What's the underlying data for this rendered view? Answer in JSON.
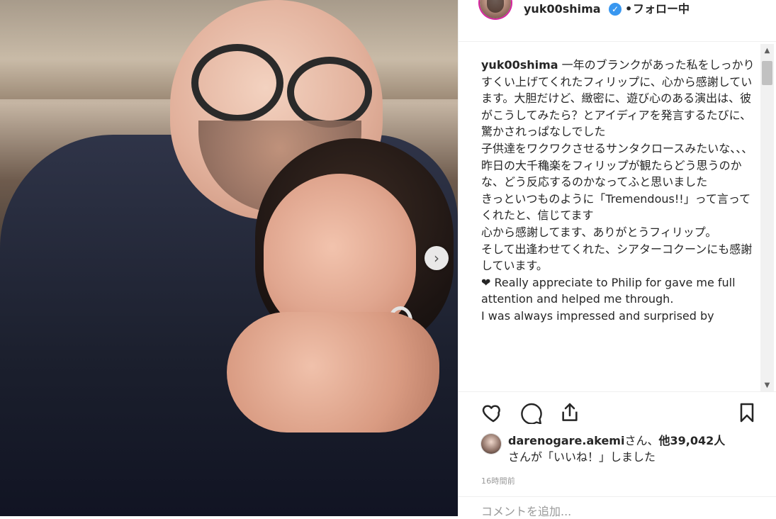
{
  "post": {
    "username": "yuk00shima",
    "dot": "•",
    "follow_status": "フォロー中",
    "caption_author": "yuk00shima",
    "caption_text": " 一年のブランクがあった私をしっかりすくい上げてくれたフィリップに、心から感謝しています。大胆だけど、緻密に、遊び心のある演出は、彼がこうしてみたら？とアイディアを発言するたびに、驚かされっぱなしでした\n子供達をワクワクさせるサンタクロースみたいな、、、\n昨日の大千穐楽をフィリップが観たらどう思うのかな、どう反応するのかなってふと思いました\nきっといつものように「Tremendous!!」って言ってくれたと、信じてます\n心から感謝してます、ありがとうフィリップ。\nそして出逢わせてくれた、シアターコクーンにも感謝しています。\n❤ Really appreciate to Philip for gave me full attention and helped me through.\nI was always impressed and surprised by",
    "likes": {
      "user": "darenogare.akemi",
      "middle": "さん、",
      "others": "他39,042人",
      "suffix": "さんが「いいね！」しました"
    },
    "timestamp": "16時間前",
    "comment_placeholder": "コメントを追加..."
  },
  "icons": {
    "verified": "verified-badge-icon",
    "like": "heart-icon",
    "comment": "comment-icon",
    "share": "share-icon",
    "save": "bookmark-icon",
    "next": "chevron-right-icon"
  },
  "scrollbar": {
    "up": "▲",
    "down": "▼"
  },
  "colors": {
    "accent": "#3897f0",
    "text": "#262626",
    "muted": "#999999",
    "border": "#efefef"
  }
}
